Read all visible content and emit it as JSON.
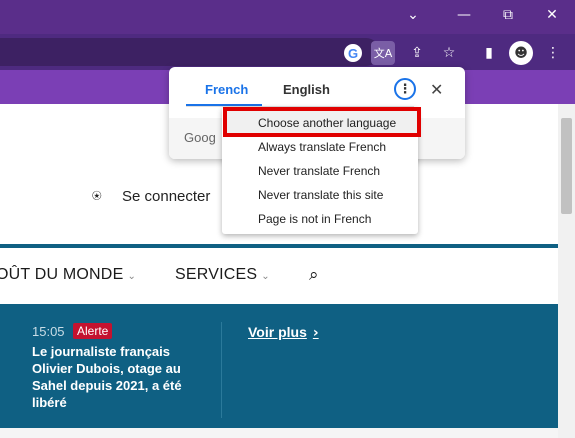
{
  "browser": {
    "window_controls": {
      "minimize": "—",
      "restore": "⧉",
      "close": "✕",
      "dropdown": "⌄"
    },
    "toolbar_icons": {
      "google": "G",
      "translate": "文A",
      "share": "⇪",
      "star": "☆",
      "sidepanel": "▮",
      "avatar": "☻",
      "menu": "⋮"
    }
  },
  "page": {
    "connect_label": "Se connecter",
    "nav": [
      {
        "label": "OÛT DU MONDE"
      },
      {
        "label": "SERVICES"
      }
    ],
    "news": {
      "time": "15:05",
      "badge": "Alerte",
      "headline": "Le journaliste français Olivier Dubois, otage au Sahel depuis 2021, a été libéré",
      "voir_plus": "Voir plus"
    }
  },
  "translate_bubble": {
    "tabs": [
      "French",
      "English"
    ],
    "active_tab": "French",
    "footer_text": "Goog",
    "menu": [
      "Choose another language",
      "Always translate French",
      "Never translate French",
      "Never translate this site",
      "Page is not in French"
    ],
    "highlighted_item": "Choose another language"
  },
  "colors": {
    "titlebar": "#5a2e8a",
    "accent_blue": "#1a73e8",
    "news_bg": "#0f6083",
    "alert_red": "#c4122f",
    "highlight_box": "#e00000"
  }
}
